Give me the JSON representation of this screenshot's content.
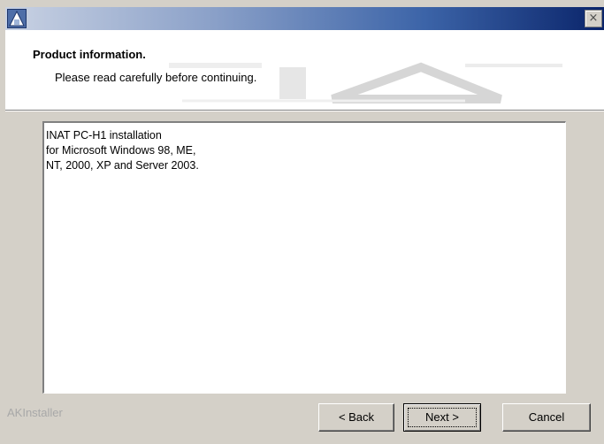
{
  "titlebar": {
    "app_icon": "installer-icon",
    "close_glyph": "×"
  },
  "header": {
    "title": "Product information.",
    "subtitle": "Please read carefully before continuing."
  },
  "content": {
    "lines": [
      "INAT PC-H1 installation",
      "",
      "for Microsoft Windows 98, ME,",
      "NT, 2000, XP and Server 2003."
    ]
  },
  "footer": {
    "brand": "AKInstaller",
    "back_label": "< Back",
    "next_label": "Next >",
    "cancel_label": "Cancel"
  }
}
